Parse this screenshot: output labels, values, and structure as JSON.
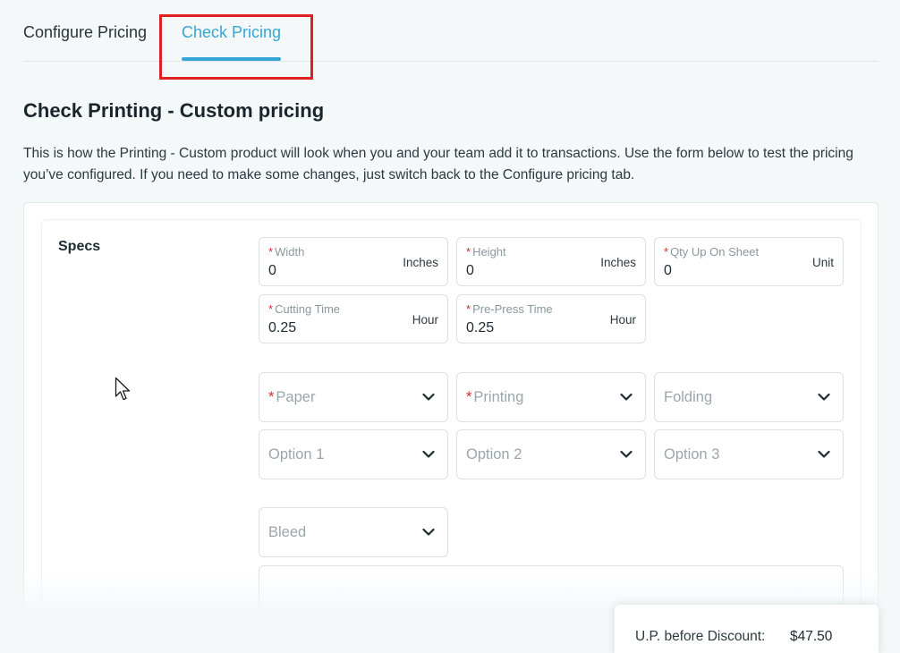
{
  "tabs": [
    {
      "label": "Configure Pricing",
      "active": false
    },
    {
      "label": "Check Pricing",
      "active": true
    }
  ],
  "page": {
    "title": "Check Printing - Custom pricing",
    "description": "This is how the Printing - Custom product will look when you and your team add it to transactions. Use the form below to test the pricing you’ve configured. If you need to make some changes, just switch back to the Configure pricing tab."
  },
  "specs": {
    "label": "Specs",
    "fields": [
      {
        "label": "Width",
        "value": "0",
        "unit": "Inches",
        "required": true
      },
      {
        "label": "Height",
        "value": "0",
        "unit": "Inches",
        "required": true
      },
      {
        "label": "Qty Up On Sheet",
        "value": "0",
        "unit": "Unit",
        "required": true
      },
      {
        "label": "Cutting Time",
        "value": "0.25",
        "unit": "Hour",
        "required": true
      },
      {
        "label": "Pre-Press Time",
        "value": "0.25",
        "unit": "Hour",
        "required": true
      }
    ],
    "selects": [
      {
        "placeholder": "Paper",
        "required": true
      },
      {
        "placeholder": "Printing",
        "required": true
      },
      {
        "placeholder": "Folding",
        "required": false
      },
      {
        "placeholder": "Option 1",
        "required": false
      },
      {
        "placeholder": "Option 2",
        "required": false
      },
      {
        "placeholder": "Option 3",
        "required": false
      },
      {
        "placeholder": "Bleed",
        "required": false
      }
    ],
    "required_marker": "*"
  },
  "pricing": {
    "label": "U.P. before Discount:",
    "value": "$47.50"
  },
  "colors": {
    "accent": "#35a7d5",
    "required": "#d0302f",
    "highlight": "#e02020"
  },
  "icons": {
    "dropdown": "chevron-down-icon",
    "cursor": "mouse-pointer-icon"
  }
}
